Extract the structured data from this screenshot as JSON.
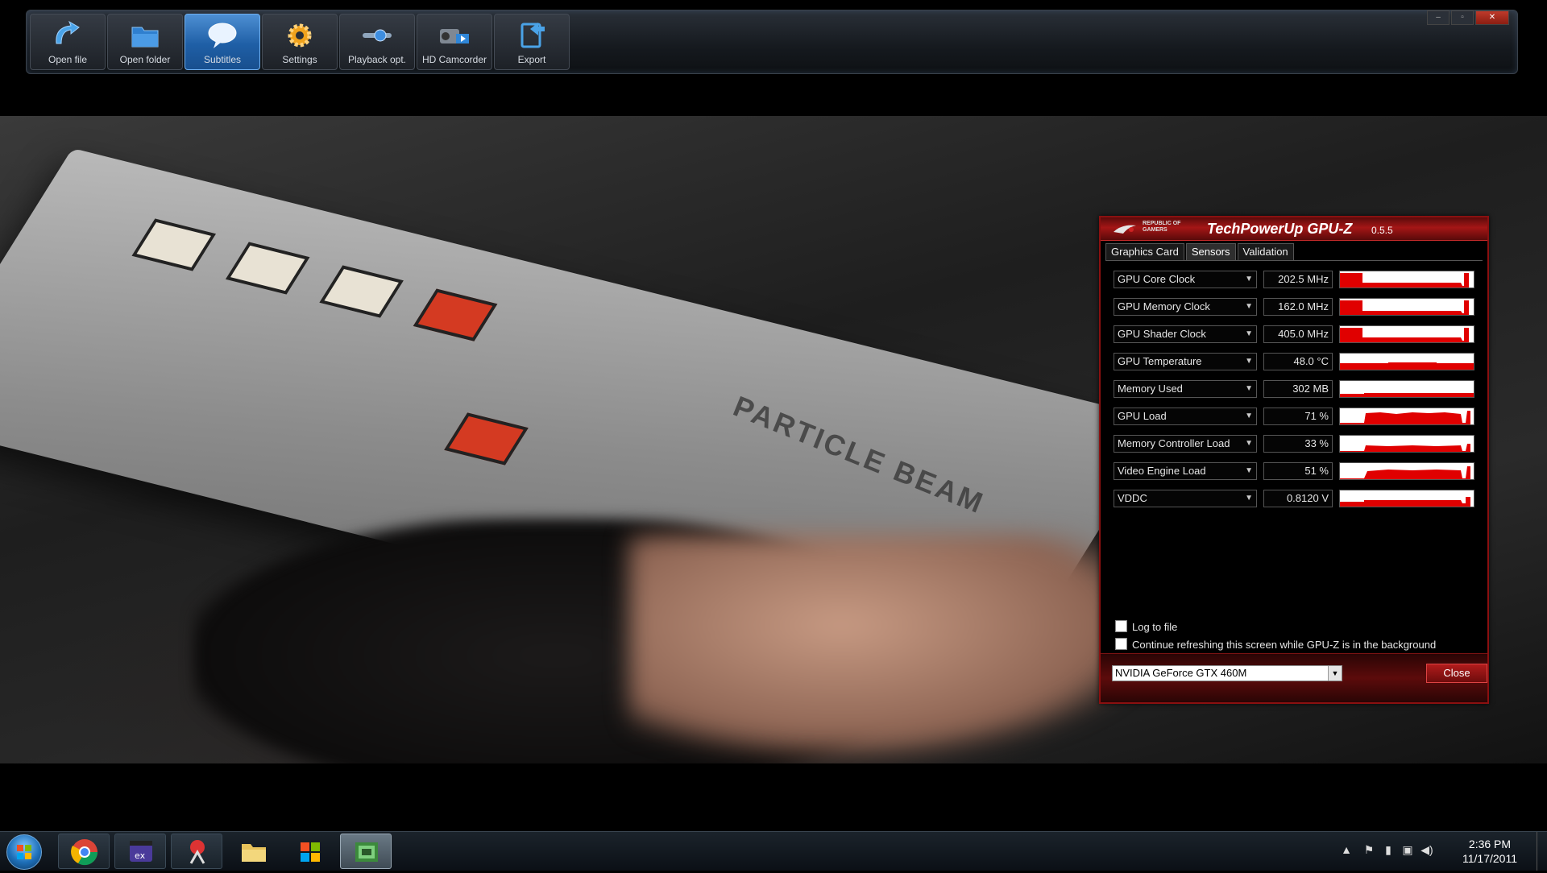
{
  "toolbar": {
    "buttons": [
      {
        "label": "Open file",
        "icon": "open-file-icon"
      },
      {
        "label": "Open folder",
        "icon": "folder-icon"
      },
      {
        "label": "Subtitles",
        "icon": "speech-bubble-icon",
        "active": true
      },
      {
        "label": "Settings",
        "icon": "gear-icon"
      },
      {
        "label": "Playback opt.",
        "icon": "slider-icon"
      },
      {
        "label": "HD Camcorder",
        "icon": "camcorder-icon"
      },
      {
        "label": "Export",
        "icon": "export-icon"
      }
    ],
    "close_glyph": "✕"
  },
  "video": {
    "engraving": "PARTICLE BEAM"
  },
  "gpuz": {
    "logo_text": "REPUBLIC OF GAMERS",
    "title": "TechPowerUp GPU-Z",
    "version": "0.5.5",
    "tabs": [
      {
        "label": "Graphics Card"
      },
      {
        "label": "Sensors",
        "active": true
      },
      {
        "label": "Validation"
      }
    ],
    "sensors": [
      {
        "name": "GPU Core Clock",
        "value": "202.5 MHz"
      },
      {
        "name": "GPU Memory Clock",
        "value": "162.0 MHz"
      },
      {
        "name": "GPU Shader Clock",
        "value": "405.0 MHz"
      },
      {
        "name": "GPU Temperature",
        "value": "48.0 °C"
      },
      {
        "name": "Memory Used",
        "value": "302 MB"
      },
      {
        "name": "GPU Load",
        "value": "71 %"
      },
      {
        "name": "Memory Controller Load",
        "value": "33 %"
      },
      {
        "name": "Video Engine Load",
        "value": "51 %"
      },
      {
        "name": "VDDC",
        "value": "0.8120 V"
      }
    ],
    "log_to_file": "Log to file",
    "continue_refresh": "Continue refreshing this screen while GPU-Z is in the background",
    "selected_gpu": "NVIDIA GeForce GTX 460M",
    "close_label": "Close"
  },
  "colors": {
    "graph": "#e00000",
    "accent_blue": "#2f76c2",
    "gpuz_red": "#a51616"
  },
  "taskbar": {
    "apps": [
      "chrome-icon",
      "media-player-icon",
      "snipping-tool-icon",
      "folder-icon",
      "windows-flag-icon",
      "gpu-z-icon"
    ],
    "time": "2:36 PM",
    "date": "11/17/2011"
  }
}
